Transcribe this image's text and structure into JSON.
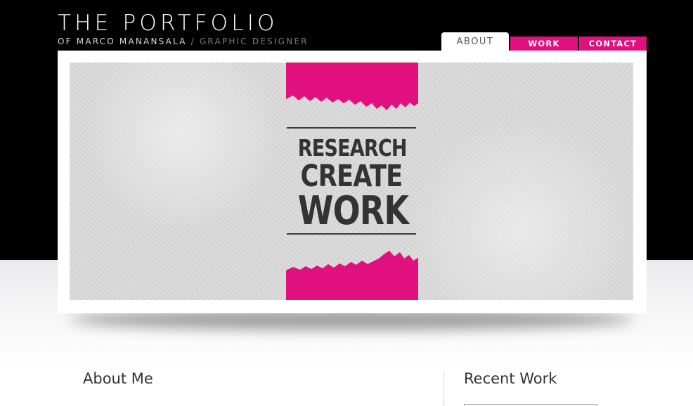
{
  "header": {
    "title": "THE PORTFOLIO",
    "subtitle_owner": "OF MARCO MANANSALA",
    "subtitle_separator": "/",
    "subtitle_role": "GRAPHIC DESIGNER"
  },
  "nav": {
    "items": [
      {
        "label": "ABOUT",
        "active": true
      },
      {
        "label": "WORK",
        "active": false
      },
      {
        "label": "CONTACT",
        "active": false
      }
    ],
    "accent_color": "#e0117e"
  },
  "hero": {
    "motto_line1": "RESEARCH",
    "motto_line2": "CREATE",
    "motto_line3": "WORK",
    "brush_color": "#e0117e"
  },
  "sections": {
    "about_heading": "About Me",
    "recent_heading": "Recent Work"
  }
}
